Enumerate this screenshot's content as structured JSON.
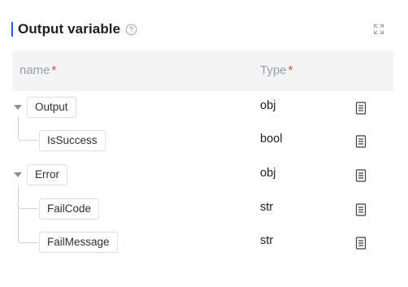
{
  "header": {
    "title": "Output variable",
    "help_icon": "question-circle-icon",
    "expand_icon": "expand-arrows-icon",
    "accent_color": "#2f54eb"
  },
  "table": {
    "col_name": "name",
    "col_type": "Type",
    "required_mark": "*",
    "rows": [
      {
        "name": "Output",
        "type": "obj",
        "level": 0,
        "expandable": true
      },
      {
        "name": "IsSuccess",
        "type": "bool",
        "level": 1,
        "expandable": false
      },
      {
        "name": "Error",
        "type": "obj",
        "level": 0,
        "expandable": true
      },
      {
        "name": "FailCode",
        "type": "str",
        "level": 1,
        "expandable": false
      },
      {
        "name": "FailMessage",
        "type": "str",
        "level": 1,
        "expandable": false
      }
    ],
    "row_action_icon": "document-list-icon"
  }
}
